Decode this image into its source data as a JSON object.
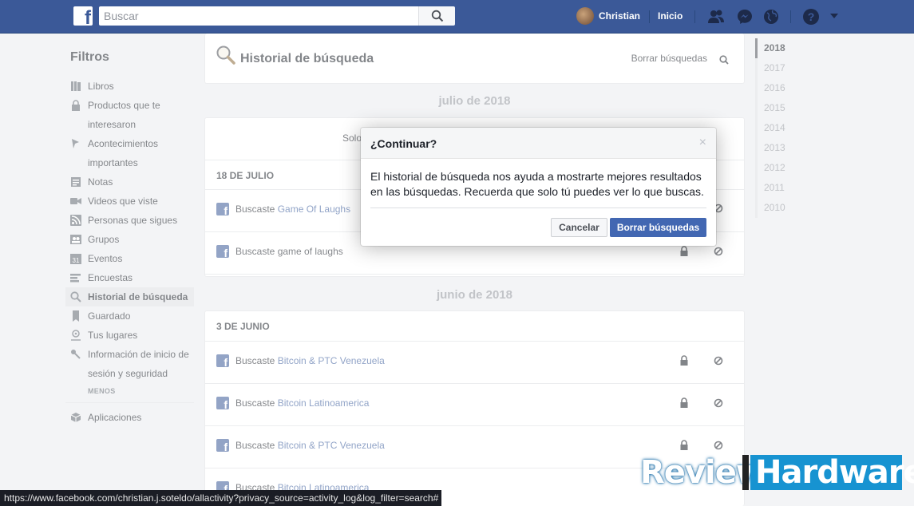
{
  "topbar": {
    "search_placeholder": "Buscar",
    "user_name": "Christian",
    "home_label": "Inicio",
    "icons": [
      "friends-icon",
      "messenger-icon",
      "globe-icon",
      "help-icon",
      "caret-down-icon"
    ]
  },
  "sidebar": {
    "title": "Filtros",
    "items": [
      {
        "label": "Libros",
        "icon": "books-icon"
      },
      {
        "label": "Productos que te interesaron",
        "icon": "lock-bag-icon"
      },
      {
        "label": "Acontecimientos importantes",
        "icon": "flag-icon"
      },
      {
        "label": "Notas",
        "icon": "notes-icon"
      },
      {
        "label": "Videos que viste",
        "icon": "video-icon"
      },
      {
        "label": "Personas que sigues",
        "icon": "rss-icon"
      },
      {
        "label": "Grupos",
        "icon": "groups-icon"
      },
      {
        "label": "Eventos",
        "icon": "calendar-icon"
      },
      {
        "label": "Encuestas",
        "icon": "poll-icon"
      },
      {
        "label": "Historial de búsqueda",
        "icon": "search-icon",
        "active": true
      },
      {
        "label": "Guardado",
        "icon": "bookmark-icon"
      },
      {
        "label": "Tus lugares",
        "icon": "location-icon"
      },
      {
        "label": "Información de inicio de sesión y seguridad",
        "icon": "key-icon"
      }
    ],
    "less_label": "MENOS",
    "apps_label": "Aplicaciones"
  },
  "header": {
    "title": "Historial de búsqueda",
    "clear_label": "Borrar búsquedas"
  },
  "sections": [
    {
      "month": "julio de 2018",
      "notice": "Solo",
      "days": [
        {
          "day": "18 DE JULIO",
          "rows": [
            {
              "prefix": "Buscaste",
              "link": "Game Of Laughs"
            },
            {
              "prefix": "Buscaste game of laughs",
              "link": ""
            }
          ]
        }
      ]
    },
    {
      "month": "junio de 2018",
      "days": [
        {
          "day": "3 DE JUNIO",
          "rows": [
            {
              "prefix": "Buscaste",
              "link": "Bitcoin & PTC Venezuela"
            },
            {
              "prefix": "Buscaste",
              "link": "Bitcoin Latinoamerica"
            },
            {
              "prefix": "Buscaste",
              "link": "Bitcoin & PTC Venezuela"
            },
            {
              "prefix": "Buscaste",
              "link": "Bitcoin Latinoamerica"
            }
          ]
        }
      ]
    }
  ],
  "years": [
    "2018",
    "2017",
    "2016",
    "2015",
    "2014",
    "2013",
    "2012",
    "2011",
    "2010"
  ],
  "dialog": {
    "title": "¿Continuar?",
    "close": "×",
    "body": "El historial de búsqueda nos ayuda a mostrarte mejores resultados en las búsquedas. Recuerda que solo tú puedes ver lo que buscas.",
    "cancel_label": "Cancelar",
    "confirm_label": "Borrar búsquedas"
  },
  "status_url": "https://www.facebook.com/christian.j.soteldo/allactivity?privacy_source=activity_log&log_filter=search#",
  "watermark": {
    "part1": "Review",
    "part2": "Hardware"
  },
  "colors": {
    "brand": "#3b5998",
    "link": "#365899",
    "button": "#4267b2"
  }
}
